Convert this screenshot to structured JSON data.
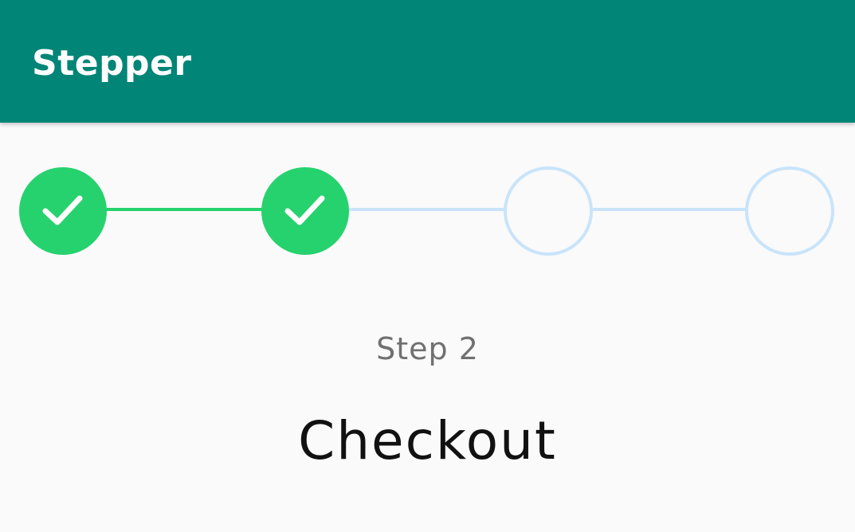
{
  "app_bar": {
    "title": "Stepper",
    "color": "#018577"
  },
  "stepper": {
    "current_step": 2,
    "total_steps": 4,
    "steps": [
      {
        "status": "completed",
        "icon": "check-icon"
      },
      {
        "status": "completed",
        "icon": "check-icon"
      },
      {
        "status": "pending",
        "icon": "empty-circle"
      },
      {
        "status": "pending",
        "icon": "empty-circle"
      }
    ],
    "completed_color": "#26d26e",
    "pending_color": "#c9e4fa"
  },
  "content": {
    "step_label": "Step 2",
    "step_title": "Checkout"
  }
}
